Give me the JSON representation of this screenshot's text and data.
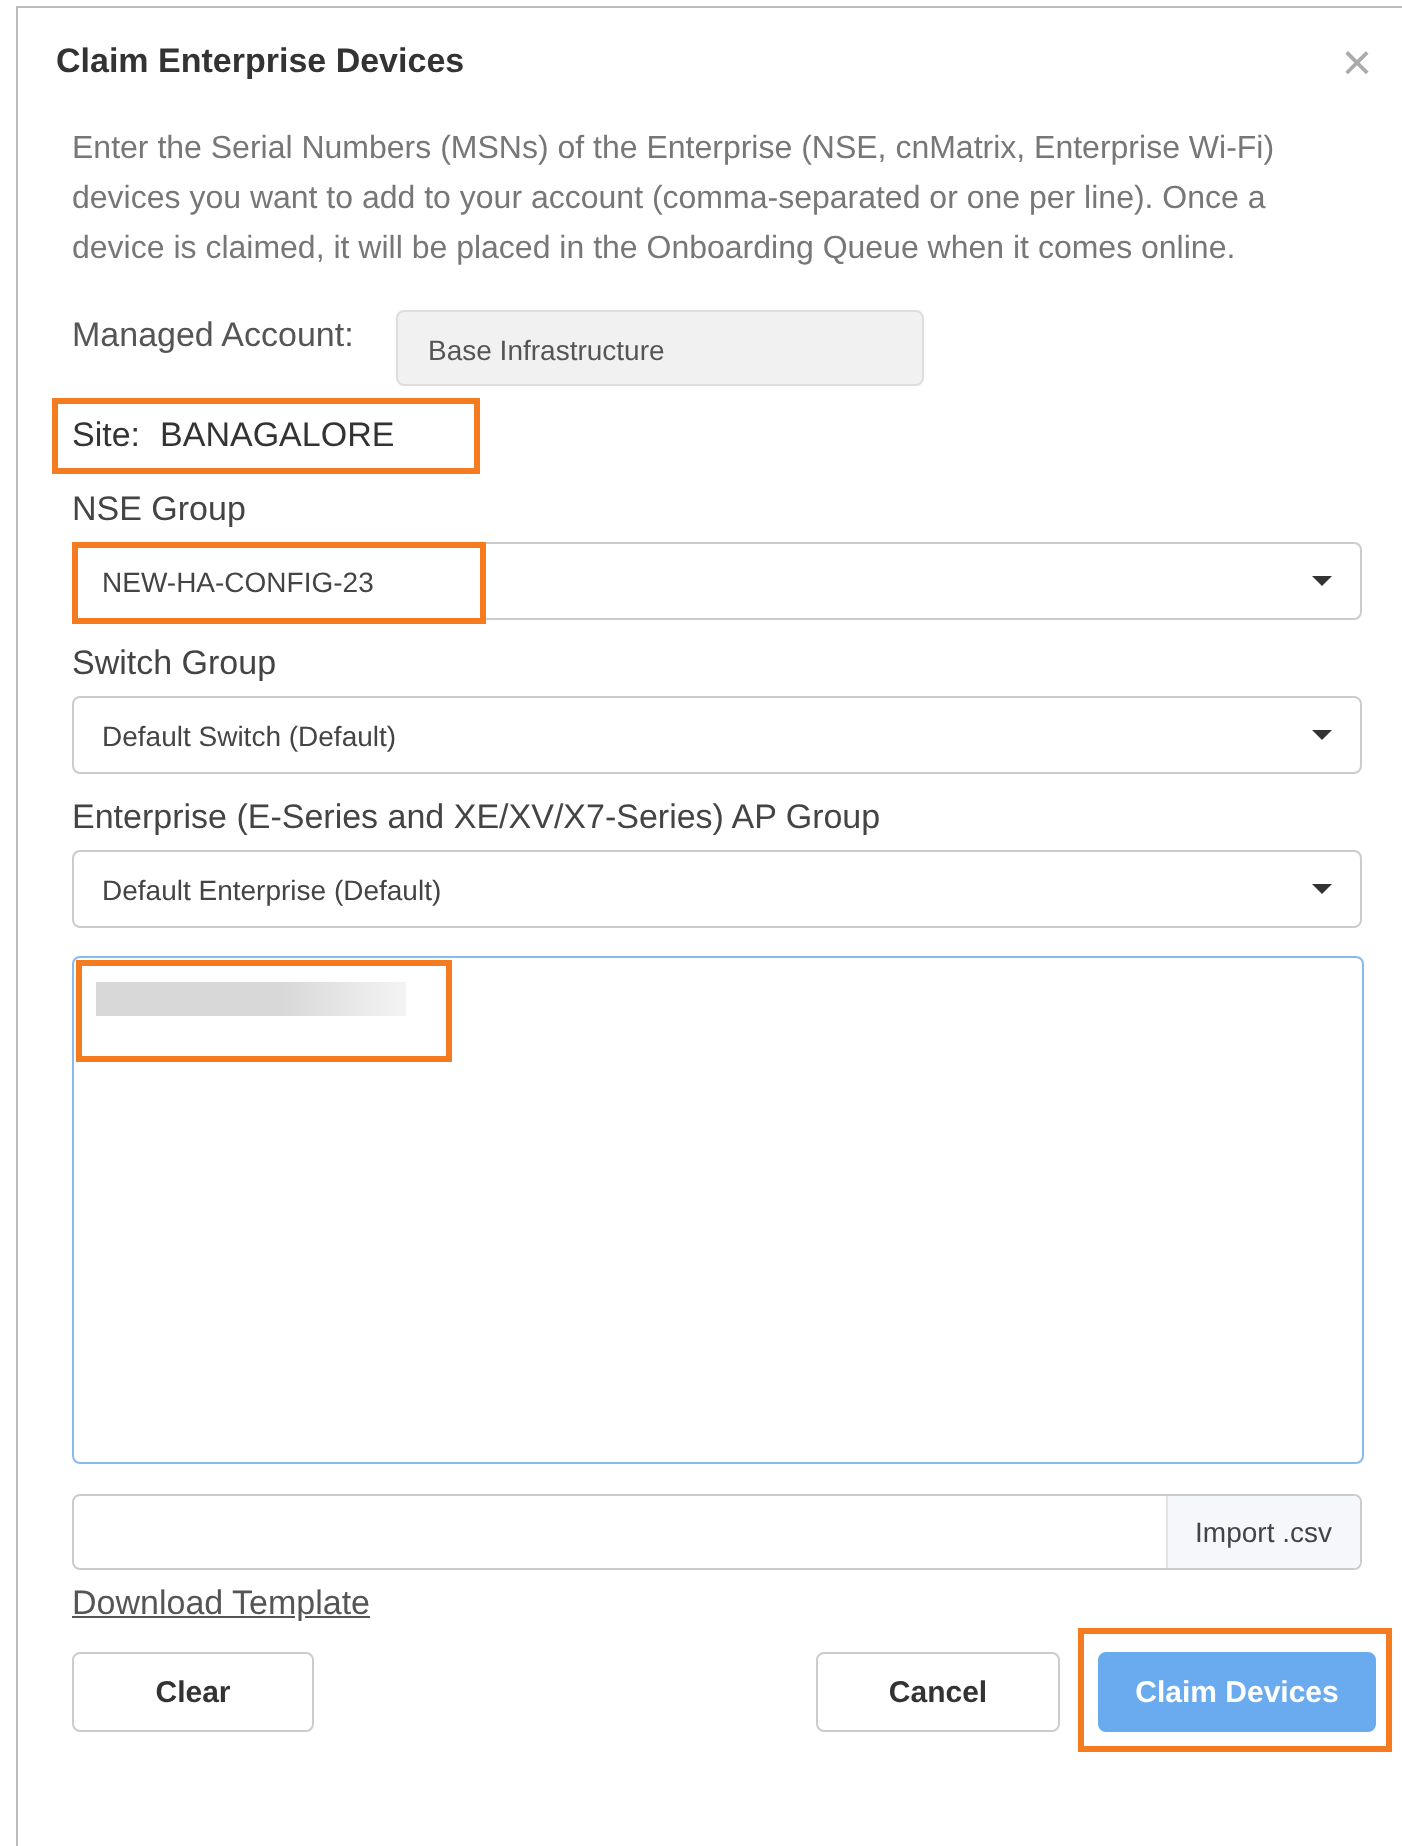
{
  "dialog": {
    "title": "Claim Enterprise Devices",
    "close": "×",
    "description": "Enter the Serial Numbers (MSNs) of the Enterprise (NSE, cnMatrix, Enterprise Wi-Fi) devices you want to add to your account (comma-separated or one per line). Once a device is claimed, it will be placed in the Onboarding Queue when it comes online.",
    "managed_account": {
      "label": "Managed Account:",
      "value": "Base Infrastructure"
    },
    "site": {
      "label": "Site:",
      "value": "BANAGALORE",
      "highlighted": true
    },
    "selects": [
      {
        "label": "NSE Group",
        "value": "NEW-HA-CONFIG-23",
        "highlighted": true
      },
      {
        "label": "Switch Group",
        "value": "Default Switch (Default)",
        "highlighted": false
      },
      {
        "label": "Enterprise (E-Series and XE/XV/X7-Series) AP Group",
        "value": "Default Enterprise (Default)",
        "highlighted": false
      }
    ],
    "serials": {
      "redacted": true,
      "highlighted": true,
      "focused": true
    },
    "import": {
      "button": "Import .csv"
    },
    "download_link": "Download Template",
    "buttons": [
      {
        "label": "Clear",
        "kind": "plain",
        "highlighted": false
      },
      {
        "label": "Cancel",
        "kind": "plain",
        "highlighted": false
      },
      {
        "label": "Claim Devices",
        "kind": "primary",
        "highlighted": true
      }
    ]
  }
}
